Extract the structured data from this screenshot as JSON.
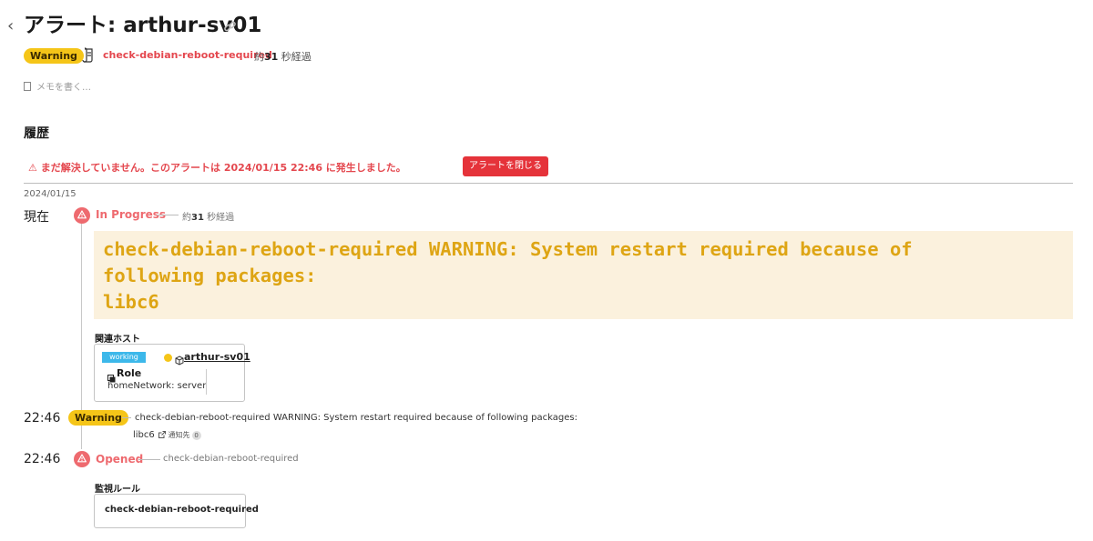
{
  "header": {
    "back_glyph": "‹",
    "title": "アラート: arthur-sv01",
    "status_badge": "Warning",
    "monitor_name": "check-debian-reboot-required",
    "elapsed_prefix": "約",
    "elapsed_num": "31",
    "elapsed_suffix": " 秒経過"
  },
  "memo": {
    "placeholder": "メモを書く…"
  },
  "history": {
    "heading": "履歴",
    "unresolved_text": "⚠ まだ解決していません。このアラートは 2024/01/15 22:46 に発生しました。",
    "close_button": "アラートを閉じる",
    "date": "2024/01/15",
    "current": {
      "time_label": "現在",
      "status": "In Progress",
      "elapsed_prefix": "約",
      "elapsed_num": "31",
      "elapsed_suffix": " 秒経過",
      "message": "check-debian-reboot-required WARNING: System restart required because of\nfollowing packages:\nlibc6",
      "related_hosts_label": "関連ホスト",
      "host": {
        "status": "working",
        "name": "arthur-sv01",
        "role_label": "Role",
        "role_value": "homeNetwork: server"
      }
    },
    "warning_event": {
      "time": "22:46",
      "badge": "Warning",
      "message_line1": "check-debian-reboot-required WARNING: System restart required because of following packages:",
      "message_line2": "libc6",
      "notify_label": "通知先",
      "notify_count": "0"
    },
    "opened_event": {
      "time": "22:46",
      "status": "Opened",
      "monitor_name": "check-debian-reboot-required",
      "monitor_rule_label": "監視ルール",
      "monitor_rule_name": "check-debian-reboot-required"
    }
  },
  "colors": {
    "alert_red": "#e4474e",
    "warning_yellow": "#f5c518",
    "message_bg": "#fbf1dd",
    "message_text": "#dea514",
    "working_blue": "#3db8ea"
  },
  "icons": [
    "chevron-left-icon",
    "link-icon",
    "document-icon",
    "memo-icon",
    "alert-triangle-icon",
    "cube-icon",
    "role-icon",
    "external-link-icon"
  ]
}
